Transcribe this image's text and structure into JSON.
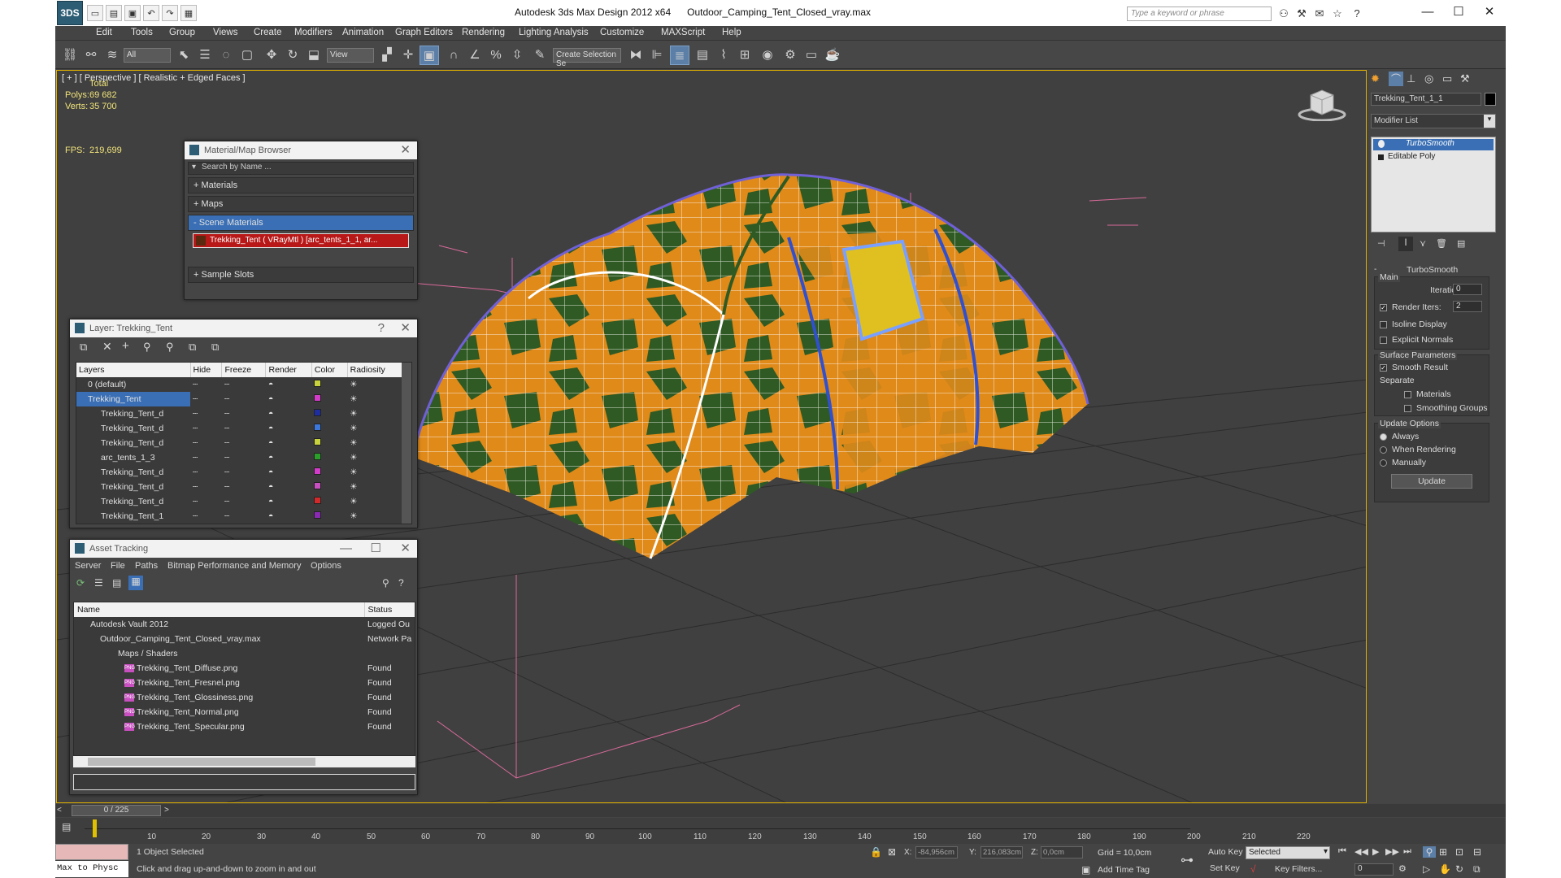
{
  "window": {
    "title": "Autodesk 3ds Max Design 2012 x64      Outdoor_Camping_Tent_Closed_vray.max",
    "logo": "3DS",
    "search_placeholder": "Type a keyword or phrase",
    "controls": [
      "—",
      "☐",
      "✕"
    ]
  },
  "menu": [
    "Edit",
    "Tools",
    "Group",
    "Views",
    "Create",
    "Modifiers",
    "Animation",
    "Graph Editors",
    "Rendering",
    "Lighting Analysis",
    "Customize",
    "MAXScript",
    "Help"
  ],
  "toolbar": {
    "selection_filter": "All",
    "ref_coord": "View",
    "named_selection": "Create Selection Se"
  },
  "viewport": {
    "label": "[ + ] [ Perspective ] [ Realistic + Edged Faces ]",
    "stats": {
      "total_label": "Total",
      "polys_label": "Polys:",
      "polys_value": "69 682",
      "verts_label": "Verts:",
      "verts_value": "35 700",
      "fps_label": "FPS:",
      "fps_value": "219,699"
    }
  },
  "material_browser": {
    "title": "Material/Map Browser",
    "search": "Search by Name ...",
    "groups": [
      "+ Materials",
      "+ Maps",
      "- Scene Materials"
    ],
    "scene_material": "Trekking_Tent  ( VRayMtl ) [arc_tents_1_1, ar...",
    "sample_slots": "+ Sample Slots"
  },
  "layer_manager": {
    "title": "Layer: Trekking_Tent",
    "help": "?",
    "columns": [
      "Layers",
      "Hide",
      "Freeze",
      "Render",
      "Color",
      "Radiosity"
    ],
    "rows": [
      {
        "name": "0 (default)",
        "color": "#c8d23c"
      },
      {
        "name": "Trekking_Tent",
        "color": "#d23cc8"
      },
      {
        "name": "Trekking_Tent_d",
        "color": "#1e2ea0"
      },
      {
        "name": "Trekking_Tent_d",
        "color": "#3c78dc"
      },
      {
        "name": "Trekking_Tent_d",
        "color": "#c8d23c"
      },
      {
        "name": "arc_tents_1_3",
        "color": "#2aa02a"
      },
      {
        "name": "Trekking_Tent_d",
        "color": "#d23cc8"
      },
      {
        "name": "Trekking_Tent_d",
        "color": "#c84fc0"
      },
      {
        "name": "Trekking_Tent_d",
        "color": "#d22a2a"
      },
      {
        "name": "Trekking_Tent_1",
        "color": "#8a2ab4"
      }
    ]
  },
  "asset_tracking": {
    "title": "Asset Tracking",
    "menu": [
      "Server",
      "File",
      "Paths",
      "Bitmap Performance and Memory",
      "Options"
    ],
    "columns": [
      "Name",
      "Status"
    ],
    "rows": [
      {
        "name": "Autodesk Vault 2012",
        "status": "Logged Ou"
      },
      {
        "name": "Outdoor_Camping_Tent_Closed_vray.max",
        "status": "Network Pa"
      },
      {
        "name": "Maps / Shaders",
        "status": ""
      },
      {
        "name": "Trekking_Tent_Diffuse.png",
        "status": "Found"
      },
      {
        "name": "Trekking_Tent_Fresnel.png",
        "status": "Found"
      },
      {
        "name": "Trekking_Tent_Glossiness.png",
        "status": "Found"
      },
      {
        "name": "Trekking_Tent_Normal.png",
        "status": "Found"
      },
      {
        "name": "Trekking_Tent_Specular.png",
        "status": "Found"
      }
    ]
  },
  "command_panel": {
    "object_name": "Trekking_Tent_1_1",
    "modifier_list": "Modifier List",
    "stack": [
      "TurboSmooth",
      "Editable Poly"
    ],
    "rollout_title": "TurboSmooth",
    "main_label": "Main",
    "iterations_label": "Iterations:",
    "iterations_value": "0",
    "render_iters_label": "Render Iters:",
    "render_iters_value": "2",
    "isoline": "Isoline Display",
    "explicit_normals": "Explicit Normals",
    "surface_params": "Surface Parameters",
    "smooth_result": "Smooth Result",
    "separate": "Separate",
    "materials": "Materials",
    "smoothing_groups": "Smoothing Groups",
    "update_options": "Update Options",
    "always": "Always",
    "when_rendering": "When Rendering",
    "manually": "Manually",
    "update_button": "Update"
  },
  "timeline": {
    "frame": "0 / 225",
    "ticks": [
      "10",
      "20",
      "30",
      "40",
      "50",
      "60",
      "70",
      "80",
      "90",
      "100",
      "110",
      "120",
      "130",
      "140",
      "150",
      "160",
      "170",
      "180",
      "190",
      "200",
      "210",
      "220"
    ]
  },
  "status": {
    "maxscript": "Max to Physc",
    "selected": "1 Object Selected",
    "prompt": "Click and drag up-and-down to zoom in and out",
    "x_label": "X:",
    "x_value": "-84,956cm",
    "y_label": "Y:",
    "y_value": "216,083cm",
    "z_label": "Z:",
    "z_value": "0,0cm",
    "grid": "Grid = 10,0cm",
    "add_time_tag": "Add Time Tag",
    "auto_key": "Auto Key",
    "set_key": "Set Key",
    "selected_dropdown": "Selected",
    "key_filters": "Key Filters...",
    "frame_value": "0"
  }
}
